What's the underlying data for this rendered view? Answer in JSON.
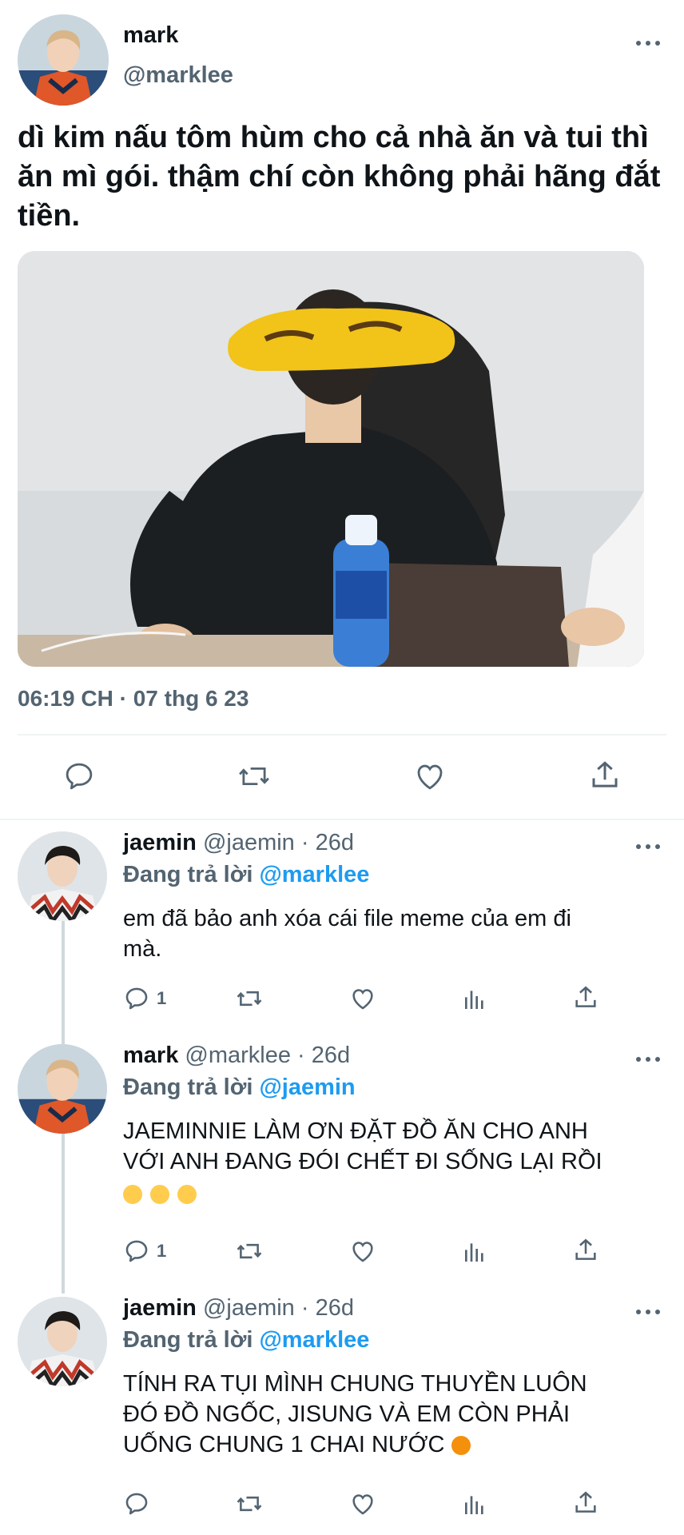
{
  "main_tweet": {
    "display_name": "mark",
    "handle": "@marklee",
    "text": "dì kim nấu tôm hùm cho cả nhà ăn và tui thì ăn mì gói. thậm chí còn không phải hãng đắt tiền.",
    "timestamp": "06:19 CH · 07 thg 6 23"
  },
  "replies": [
    {
      "display_name": "jaemin",
      "meta": "@jaemin · 26d",
      "replying_prefix": "Đang trả lời",
      "replying_to": "@marklee",
      "text_lines": [
        "em đã bảo anh xóa cái file meme của em đi",
        "mà."
      ],
      "reply_count": "1"
    },
    {
      "display_name": "mark",
      "meta": "@marklee · 26d",
      "replying_prefix": "Đang trả lời",
      "replying_to": "@jaemin",
      "text_lines": [
        "JAEMINNIE LÀM ƠN ĐẶT ĐỒ ĂN CHO ANH",
        "VỚI ANH ĐANG ĐÓI CHẾT ĐI SỐNG LẠI RỒI"
      ],
      "reply_count": "1"
    },
    {
      "display_name": "jaemin",
      "meta": "@jaemin · 26d",
      "replying_prefix": "Đang trả lời",
      "replying_to": "@marklee",
      "text_lines": [
        "TÍNH RA TỤI MÌNH CHUNG THUYỀN LUÔN",
        "ĐÓ ĐỒ NGỐC, JISUNG VÀ EM CÒN PHẢI",
        "UỐNG CHUNG 1 CHAI NƯỚC"
      ]
    }
  ],
  "icons": {
    "reply": "reply-icon",
    "retweet": "retweet-icon",
    "like": "heart-icon",
    "share": "share-icon",
    "views": "views-icon",
    "more": "more-icon"
  },
  "colors": {
    "text": "#0f1419",
    "muted": "#536471",
    "accent": "#1d9bf0",
    "divider": "#eff3f4"
  }
}
